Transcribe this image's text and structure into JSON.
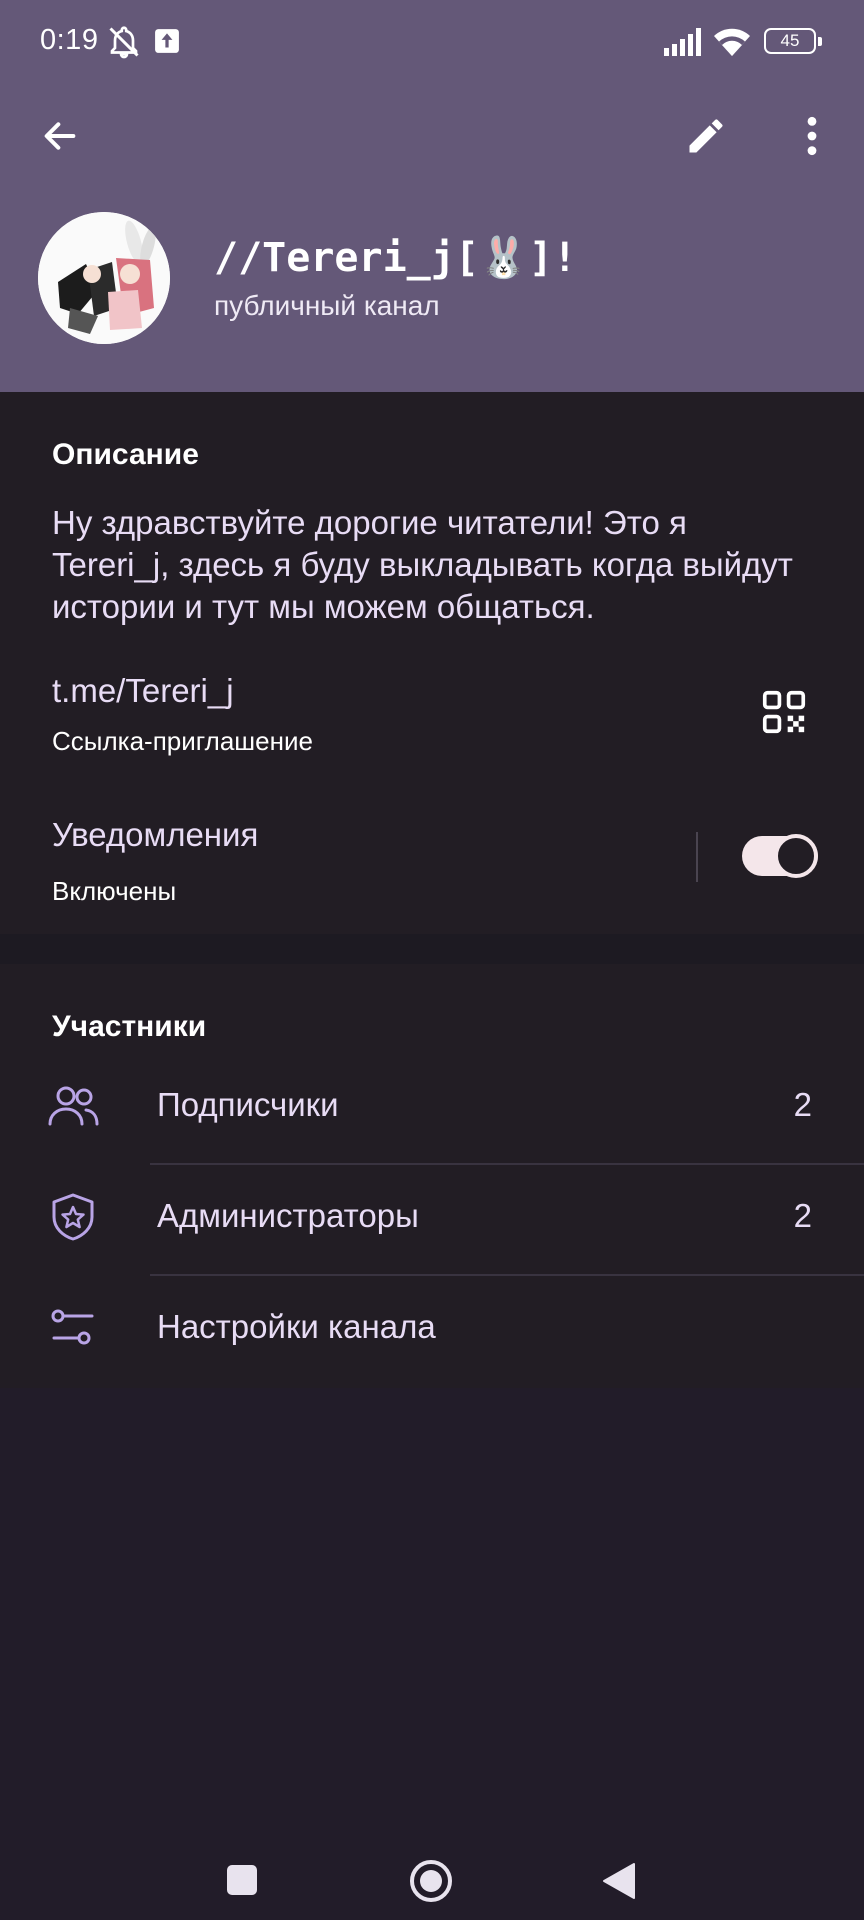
{
  "status_bar": {
    "time": "0:19",
    "battery": "45",
    "icons": [
      "bell-off-icon",
      "upload-icon",
      "signal-icon",
      "wifi-icon",
      "battery-icon"
    ]
  },
  "app_bar": {
    "icons": [
      "back-arrow-icon",
      "pencil-icon",
      "more-vert-icon"
    ]
  },
  "channel": {
    "title": "//Tereri_j[🐰]!",
    "subtitle": "публичный канал"
  },
  "info": {
    "description_header": "Описание",
    "description": "Ну здравствуйте дорогие читатели! Это я Tereri_j, здесь я буду выкладывать когда выйдут истории и тут мы можем общаться.",
    "link": "t.me/Tereri_j",
    "link_label": "Ссылка-приглашение",
    "notifications_title": "Уведомления",
    "notifications_status": "Включены",
    "notifications_enabled": true
  },
  "members": {
    "header": "Участники",
    "rows": [
      {
        "icon": "people-icon",
        "label": "Подписчики",
        "value": "2"
      },
      {
        "icon": "shield-star-icon",
        "label": "Администраторы",
        "value": "2"
      },
      {
        "icon": "sliders-icon",
        "label": "Настройки канала",
        "value": ""
      }
    ]
  },
  "colors": {
    "header_bg": "#645878",
    "section_bg": "#221d24",
    "page_bg": "#221c29",
    "accent_icon": "#b9a4e6",
    "text_primary": "#e8dcf5"
  }
}
